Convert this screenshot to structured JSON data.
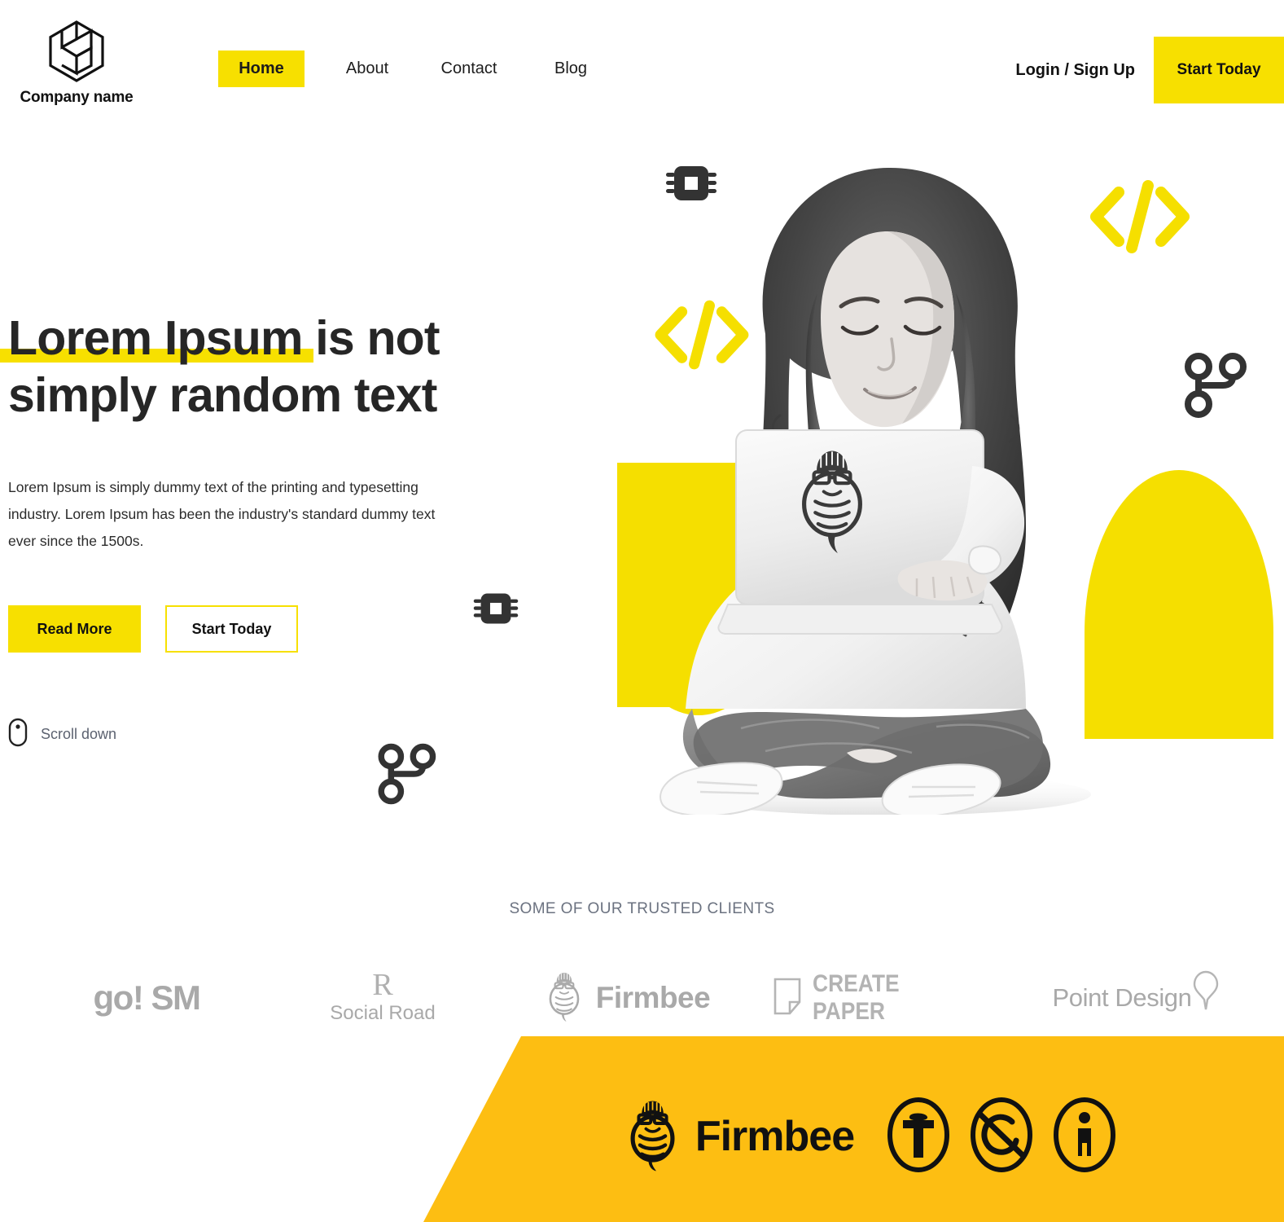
{
  "brand": {
    "name": "Company name",
    "logo_icon": "hexagon-logo-icon"
  },
  "nav": {
    "items": [
      {
        "label": "Home",
        "active": true
      },
      {
        "label": "About",
        "active": false
      },
      {
        "label": "Contact",
        "active": false
      },
      {
        "label": "Blog",
        "active": false
      }
    ],
    "login_label": "Login / Sign Up",
    "cta_label": "Start Today"
  },
  "hero": {
    "title_line1": "Lorem Ipsum is not",
    "title_line2": "simply random text",
    "subtitle": "Lorem Ipsum is simply dummy text of the printing and typesetting industry. Lorem Ipsum has been the industry's standard dummy text ever since the 1500s.",
    "primary_cta": "Read More",
    "secondary_cta": "Start Today",
    "scroll_label": "Scroll down",
    "scroll_icon": "mouse-icon",
    "decorations": [
      {
        "icon": "chip-icon",
        "color": "#333333"
      },
      {
        "icon": "chip-icon",
        "color": "#333333"
      },
      {
        "icon": "code-brackets-icon",
        "color": "#F5DF00"
      },
      {
        "icon": "code-brackets-icon",
        "color": "#F5DF00"
      },
      {
        "icon": "git-branch-icon",
        "color": "#333333"
      },
      {
        "icon": "git-branch-icon",
        "color": "#333333"
      }
    ],
    "photo_alt": "woman sitting cross-legged with laptop"
  },
  "clients": {
    "label": "SOME OF OUR TRUSTED CLIENTS",
    "logos": [
      {
        "name": "go! SM",
        "icon": "gosm-logo-icon"
      },
      {
        "name": "Social Road",
        "mark": "R",
        "icon": "social-road-logo-icon"
      },
      {
        "name": "Firmbee",
        "icon": "firmbee-bee-icon"
      },
      {
        "name": "CREATE PAPER",
        "icon": "create-paper-logo-icon"
      },
      {
        "name": "Point Design",
        "icon": "point-design-logo-icon"
      }
    ]
  },
  "banner": {
    "brand": "Firmbee",
    "brand_icon": "firmbee-bee-icon",
    "icons": [
      {
        "name": "wordpress-icon"
      },
      {
        "name": "creative-commons-nc-icon"
      },
      {
        "name": "accessibility-icon"
      }
    ]
  },
  "colors": {
    "accent_yellow": "#F7E000",
    "shape_yellow": "#F5DF00",
    "banner_yellow": "#FDBE12",
    "ink": "#262626",
    "muted": "#6b7280",
    "logo_grey": "#a9a9a9"
  }
}
